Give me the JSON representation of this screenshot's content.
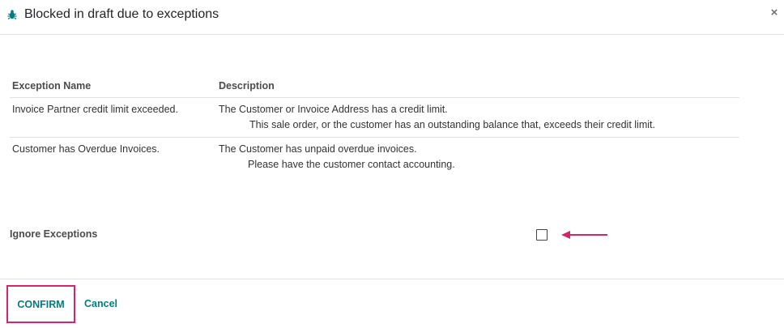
{
  "dialog": {
    "title": "Blocked in draft due to exceptions",
    "close_glyph": "×",
    "icon": "bug-icon"
  },
  "table": {
    "headers": [
      "Exception Name",
      "Description"
    ],
    "rows": [
      {
        "name": "Invoice Partner credit limit exceeded.",
        "desc_line1": "The Customer or Invoice Address has a credit limit.",
        "desc_line2": "This sale order, or the customer has an outstanding balance that, exceeds their credit limit."
      },
      {
        "name": "Customer has Overdue Invoices.",
        "desc_line1": "The Customer has unpaid overdue invoices.",
        "desc_line2": "Please have the customer contact accounting."
      }
    ]
  },
  "ignore": {
    "label": "Ignore Exceptions",
    "checked": false
  },
  "footer": {
    "confirm_label": "CONFIRM",
    "cancel_label": "Cancel"
  },
  "colors": {
    "accent": "#017e84",
    "highlight": "#d6246e"
  }
}
